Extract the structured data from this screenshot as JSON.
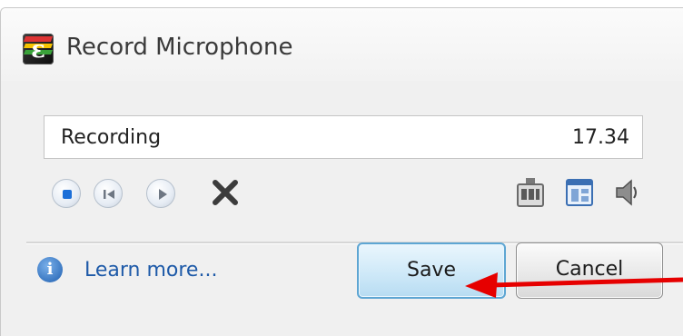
{
  "window": {
    "title": "Record Microphone",
    "app_icon": "app-logo-icon"
  },
  "recording": {
    "name": "Recording",
    "time": "17.34"
  },
  "controls": {
    "icons": [
      "stop-icon",
      "skip-back-icon",
      "play-icon",
      "delete-icon",
      "device-settings-icon",
      "panel-icon",
      "speaker-icon"
    ]
  },
  "footer": {
    "info_icon": "info-icon",
    "learn_more": "Learn more...",
    "save_label": "Save",
    "cancel_label": "Cancel"
  },
  "annotation": {
    "arrow_color": "#e60000",
    "arrow_target": "save-button"
  },
  "colors": {
    "link": "#1e5aa8",
    "save_border": "#5ea6d3"
  }
}
